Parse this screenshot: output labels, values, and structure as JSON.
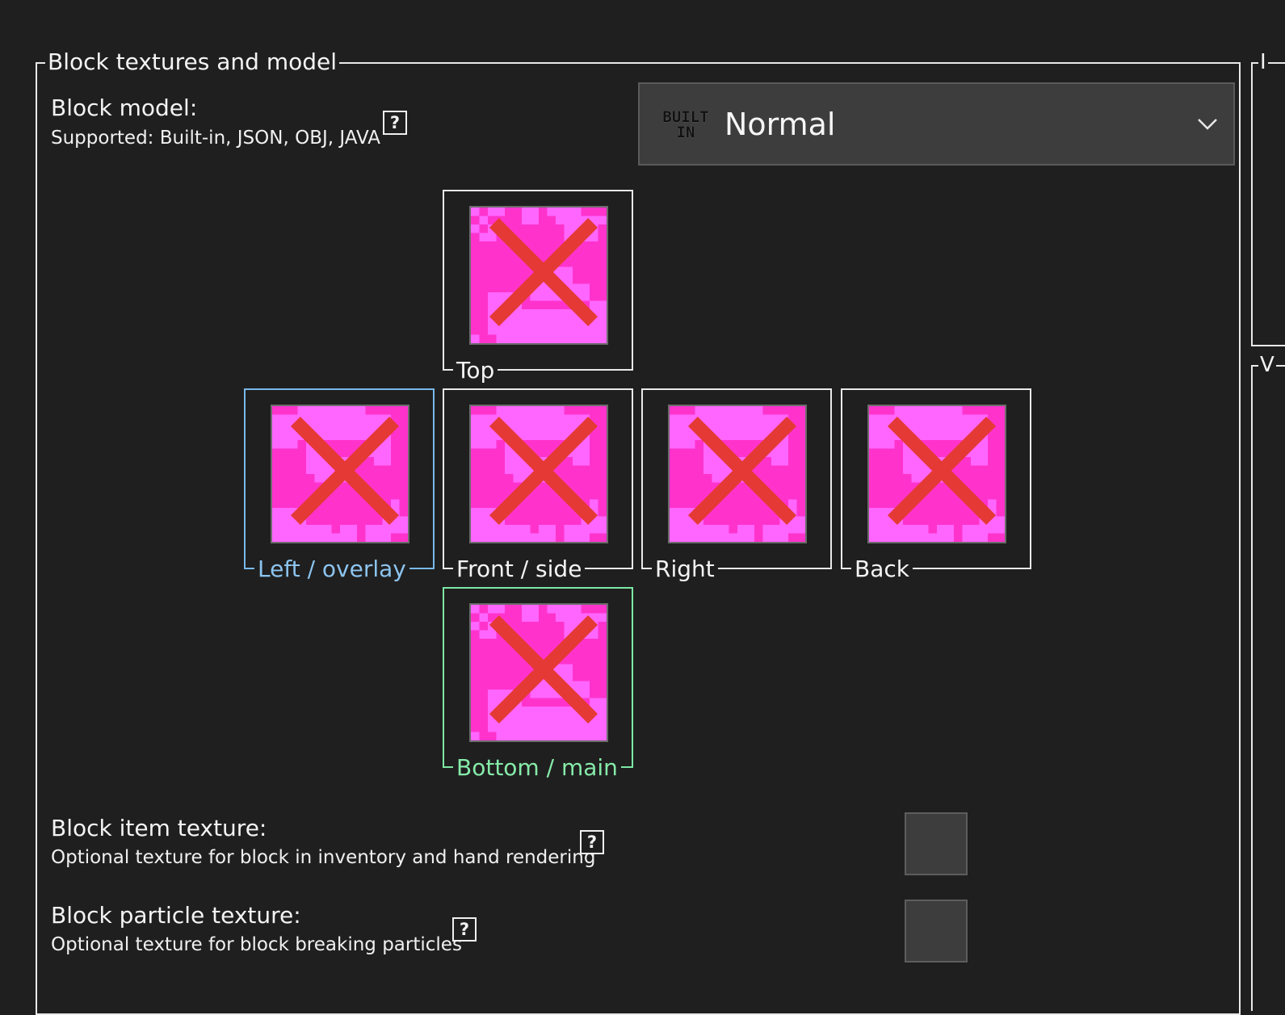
{
  "group": {
    "title": "Block textures and model"
  },
  "model": {
    "label": "Block model:",
    "supported": "Supported: Built-in, JSON, OBJ, JAVA",
    "help": "?",
    "dropdown": {
      "badge_line1": "BUILT",
      "badge_line2": "IN",
      "value": "Normal",
      "icon": "chevron-down-icon"
    }
  },
  "textures": {
    "top": {
      "caption": "Top"
    },
    "left": {
      "caption": "Left / overlay",
      "color": "#8cc4ef"
    },
    "front": {
      "caption": "Front / side"
    },
    "right": {
      "caption": "Right"
    },
    "back": {
      "caption": "Back"
    },
    "bottom": {
      "caption": "Bottom / main",
      "color": "#86eaa9"
    },
    "colors": {
      "base": "#ff33cc",
      "light": "#ff66ff",
      "remove_mark": "#e53935"
    }
  },
  "item_texture": {
    "label": "Block item texture:",
    "desc": "Optional texture for block in inventory and hand rendering",
    "help": "?"
  },
  "particle_texture": {
    "label": "Block particle texture:",
    "desc": "Optional texture for block breaking particles",
    "help": "?"
  },
  "side_fragments": {
    "a": "I",
    "b": "V"
  }
}
